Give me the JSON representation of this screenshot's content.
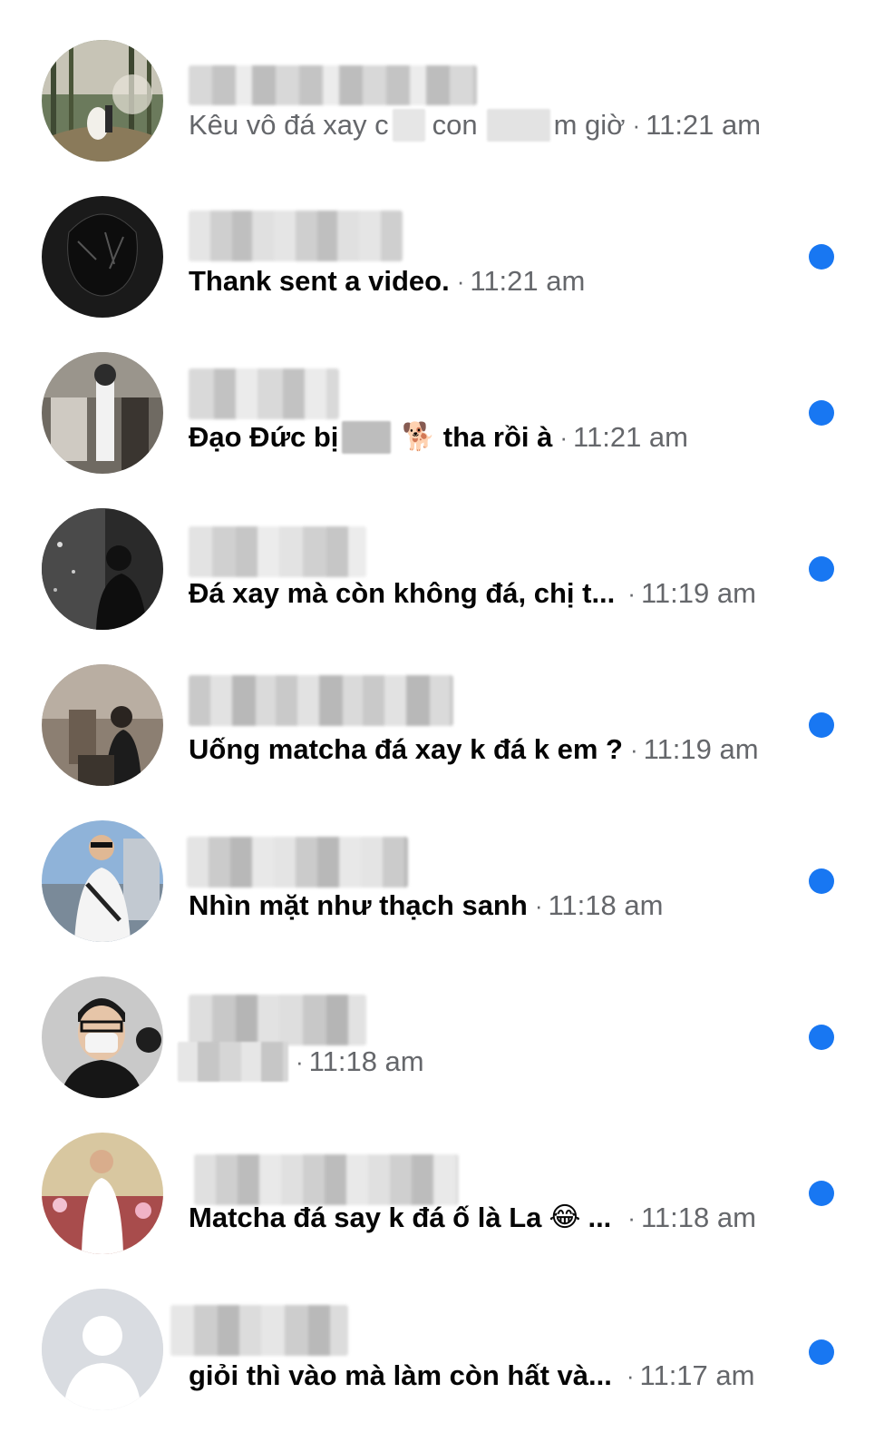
{
  "conversations": [
    {
      "message_a": "Kêu vô đá xay c",
      "message_b": "con",
      "message_c": "m giờ",
      "time": "11:21 am",
      "unread": false
    },
    {
      "message": "Thank sent a video.",
      "time": "11:21 am",
      "unread": true
    },
    {
      "message_a": "Đạo Đức bị",
      "emoji": "🐕",
      "message_b": "tha rồi à",
      "time": "11:21 am",
      "unread": true
    },
    {
      "message": "Đá xay mà còn không đá, chị t...",
      "time": "11:19 am",
      "unread": true
    },
    {
      "message": "Uống matcha đá xay k đá k em ?",
      "time": "11:19 am",
      "unread": true
    },
    {
      "message": "Nhìn mặt như thạch sanh",
      "time": "11:18 am",
      "unread": true
    },
    {
      "message": "",
      "time": "11:18 am",
      "unread": true
    },
    {
      "message_a": "Matcha đá say k đá ố là La",
      "emoji": "😂",
      "message_b": "...",
      "time": "11:18 am",
      "unread": true
    },
    {
      "message": "giỏi thì vào mà làm còn hất và...",
      "time": "11:17 am",
      "unread": true
    }
  ],
  "separator": "·",
  "colors": {
    "unread_dot": "#1877f2",
    "meta_text": "#65676b",
    "primary_text": "#050505"
  }
}
